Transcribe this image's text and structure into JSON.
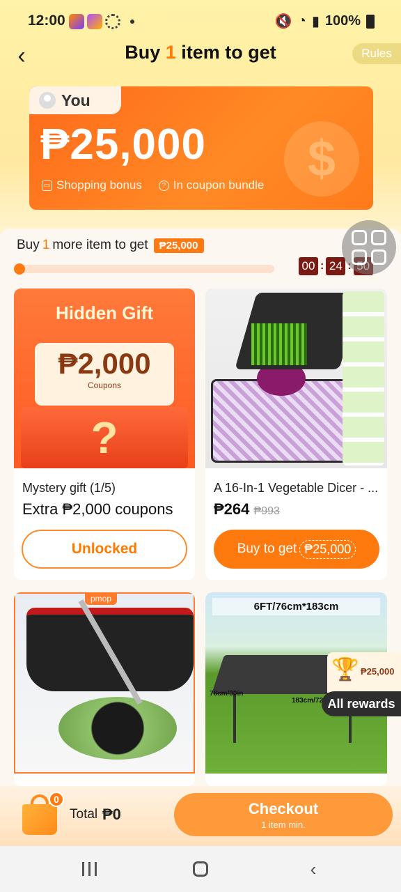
{
  "status_bar": {
    "time": "12:00",
    "battery": "100%"
  },
  "header": {
    "title_prefix": "Buy ",
    "title_count": "1",
    "title_suffix": " item to get",
    "rules_label": "Rules"
  },
  "bonus_card": {
    "you_label": "You",
    "amount": "₱25,000",
    "shopping_bonus_label": "Shopping bonus",
    "coupon_bundle_label": "In coupon bundle",
    "coin_symbol": "$"
  },
  "progress": {
    "label_prefix": "Buy ",
    "label_count": "1",
    "label_suffix": " more item to get",
    "reward": "₱25,000",
    "fill_fraction": 0.0,
    "countdown": {
      "hours": "00",
      "minutes": "24",
      "seconds": "50"
    }
  },
  "products": [
    {
      "type": "mystery",
      "image_title": "Hidden Gift",
      "image_amount": "₱2,000",
      "image_caption": "Coupons",
      "image_box_symbol": "?",
      "title": "Mystery gift (1/5)",
      "subtitle": "Extra ₱2,000 coupons",
      "button_label": "Unlocked"
    },
    {
      "type": "dicer",
      "title": "A 16-In-1 Vegetable Dicer - ...",
      "price": "₱264",
      "original_price": "₱993",
      "button_label": "Buy to get",
      "button_reward": "₱25,000"
    },
    {
      "type": "mop",
      "brand_tag": "pmop"
    },
    {
      "type": "table",
      "banner": "6FT/76cm*183cm",
      "dim_left": "76cm/30in",
      "dim_front": "183cm/72"
    }
  ],
  "rewards_floater": {
    "amount": "₱25,000",
    "label": "All rewards"
  },
  "bottom_bar": {
    "cart_count": "0",
    "total_label": "Total",
    "total_value": "₱0",
    "checkout_label": "Checkout",
    "checkout_sub": "1 item min."
  },
  "colors": {
    "accent": "#ff7a0e",
    "countdown_bg": "#7a1a12"
  },
  "icons": {
    "back": "chevron-left-icon",
    "float_menu": "grid-icon",
    "cart": "shopping-bag-icon",
    "trophy": "trophy-icon"
  }
}
